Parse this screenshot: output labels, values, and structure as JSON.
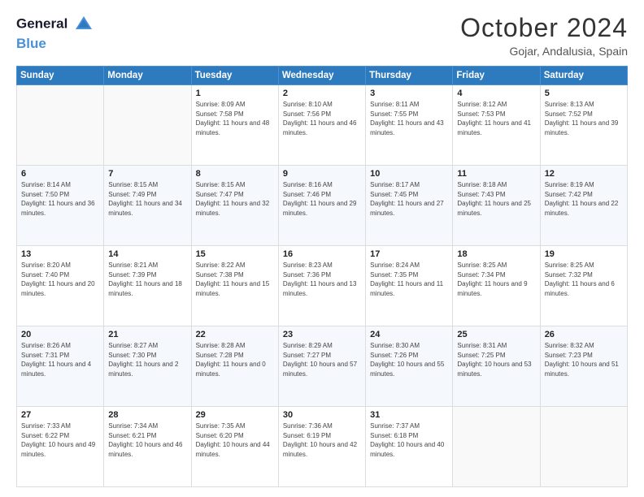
{
  "header": {
    "logo_line1": "General",
    "logo_line2": "Blue",
    "month": "October 2024",
    "location": "Gojar, Andalusia, Spain"
  },
  "days_of_week": [
    "Sunday",
    "Monday",
    "Tuesday",
    "Wednesday",
    "Thursday",
    "Friday",
    "Saturday"
  ],
  "weeks": [
    [
      {
        "day": "",
        "info": ""
      },
      {
        "day": "",
        "info": ""
      },
      {
        "day": "1",
        "info": "Sunrise: 8:09 AM\nSunset: 7:58 PM\nDaylight: 11 hours and 48 minutes."
      },
      {
        "day": "2",
        "info": "Sunrise: 8:10 AM\nSunset: 7:56 PM\nDaylight: 11 hours and 46 minutes."
      },
      {
        "day": "3",
        "info": "Sunrise: 8:11 AM\nSunset: 7:55 PM\nDaylight: 11 hours and 43 minutes."
      },
      {
        "day": "4",
        "info": "Sunrise: 8:12 AM\nSunset: 7:53 PM\nDaylight: 11 hours and 41 minutes."
      },
      {
        "day": "5",
        "info": "Sunrise: 8:13 AM\nSunset: 7:52 PM\nDaylight: 11 hours and 39 minutes."
      }
    ],
    [
      {
        "day": "6",
        "info": "Sunrise: 8:14 AM\nSunset: 7:50 PM\nDaylight: 11 hours and 36 minutes."
      },
      {
        "day": "7",
        "info": "Sunrise: 8:15 AM\nSunset: 7:49 PM\nDaylight: 11 hours and 34 minutes."
      },
      {
        "day": "8",
        "info": "Sunrise: 8:15 AM\nSunset: 7:47 PM\nDaylight: 11 hours and 32 minutes."
      },
      {
        "day": "9",
        "info": "Sunrise: 8:16 AM\nSunset: 7:46 PM\nDaylight: 11 hours and 29 minutes."
      },
      {
        "day": "10",
        "info": "Sunrise: 8:17 AM\nSunset: 7:45 PM\nDaylight: 11 hours and 27 minutes."
      },
      {
        "day": "11",
        "info": "Sunrise: 8:18 AM\nSunset: 7:43 PM\nDaylight: 11 hours and 25 minutes."
      },
      {
        "day": "12",
        "info": "Sunrise: 8:19 AM\nSunset: 7:42 PM\nDaylight: 11 hours and 22 minutes."
      }
    ],
    [
      {
        "day": "13",
        "info": "Sunrise: 8:20 AM\nSunset: 7:40 PM\nDaylight: 11 hours and 20 minutes."
      },
      {
        "day": "14",
        "info": "Sunrise: 8:21 AM\nSunset: 7:39 PM\nDaylight: 11 hours and 18 minutes."
      },
      {
        "day": "15",
        "info": "Sunrise: 8:22 AM\nSunset: 7:38 PM\nDaylight: 11 hours and 15 minutes."
      },
      {
        "day": "16",
        "info": "Sunrise: 8:23 AM\nSunset: 7:36 PM\nDaylight: 11 hours and 13 minutes."
      },
      {
        "day": "17",
        "info": "Sunrise: 8:24 AM\nSunset: 7:35 PM\nDaylight: 11 hours and 11 minutes."
      },
      {
        "day": "18",
        "info": "Sunrise: 8:25 AM\nSunset: 7:34 PM\nDaylight: 11 hours and 9 minutes."
      },
      {
        "day": "19",
        "info": "Sunrise: 8:25 AM\nSunset: 7:32 PM\nDaylight: 11 hours and 6 minutes."
      }
    ],
    [
      {
        "day": "20",
        "info": "Sunrise: 8:26 AM\nSunset: 7:31 PM\nDaylight: 11 hours and 4 minutes."
      },
      {
        "day": "21",
        "info": "Sunrise: 8:27 AM\nSunset: 7:30 PM\nDaylight: 11 hours and 2 minutes."
      },
      {
        "day": "22",
        "info": "Sunrise: 8:28 AM\nSunset: 7:28 PM\nDaylight: 11 hours and 0 minutes."
      },
      {
        "day": "23",
        "info": "Sunrise: 8:29 AM\nSunset: 7:27 PM\nDaylight: 10 hours and 57 minutes."
      },
      {
        "day": "24",
        "info": "Sunrise: 8:30 AM\nSunset: 7:26 PM\nDaylight: 10 hours and 55 minutes."
      },
      {
        "day": "25",
        "info": "Sunrise: 8:31 AM\nSunset: 7:25 PM\nDaylight: 10 hours and 53 minutes."
      },
      {
        "day": "26",
        "info": "Sunrise: 8:32 AM\nSunset: 7:23 PM\nDaylight: 10 hours and 51 minutes."
      }
    ],
    [
      {
        "day": "27",
        "info": "Sunrise: 7:33 AM\nSunset: 6:22 PM\nDaylight: 10 hours and 49 minutes."
      },
      {
        "day": "28",
        "info": "Sunrise: 7:34 AM\nSunset: 6:21 PM\nDaylight: 10 hours and 46 minutes."
      },
      {
        "day": "29",
        "info": "Sunrise: 7:35 AM\nSunset: 6:20 PM\nDaylight: 10 hours and 44 minutes."
      },
      {
        "day": "30",
        "info": "Sunrise: 7:36 AM\nSunset: 6:19 PM\nDaylight: 10 hours and 42 minutes."
      },
      {
        "day": "31",
        "info": "Sunrise: 7:37 AM\nSunset: 6:18 PM\nDaylight: 10 hours and 40 minutes."
      },
      {
        "day": "",
        "info": ""
      },
      {
        "day": "",
        "info": ""
      }
    ]
  ]
}
